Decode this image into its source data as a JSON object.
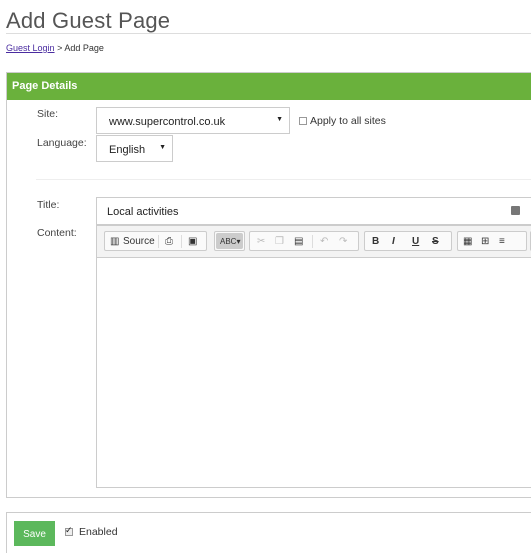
{
  "page": {
    "title": "Add Guest Page"
  },
  "breadcrumb": {
    "link": "Guest Login",
    "separator": ">",
    "current": "Add Page"
  },
  "panel": {
    "heading": "Page Details"
  },
  "form": {
    "site_label": "Site:",
    "site_value": "www.supercontrol.co.uk",
    "apply_all_label": "Apply to all sites",
    "apply_all_checked": false,
    "language_label": "Language:",
    "language_value": "English",
    "title_label": "Title:",
    "title_value": "Local activities",
    "content_label": "Content:"
  },
  "toolbar": {
    "source_label": "Source"
  },
  "footer": {
    "save_label": "Save",
    "enabled_label": "Enabled",
    "enabled_checked": true
  },
  "colors": {
    "header_green": "#6ab13c",
    "save_green": "#5cb85c",
    "link_purple": "#4a2ca0"
  }
}
